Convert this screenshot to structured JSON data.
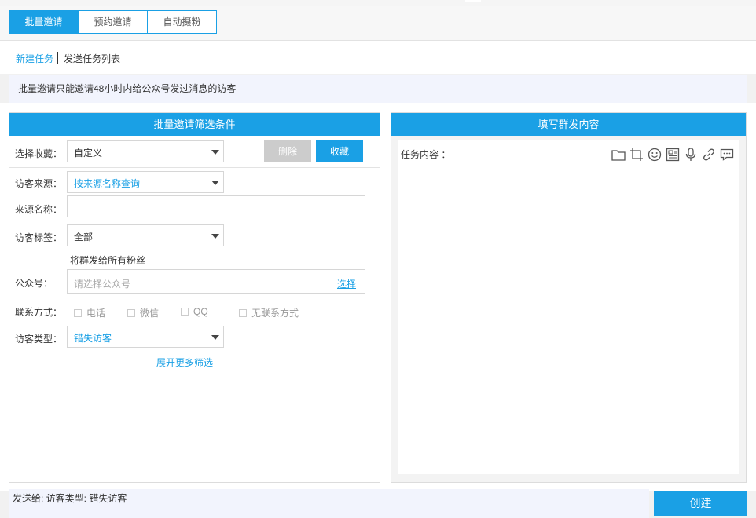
{
  "tabs": [
    {
      "label": "批量邀请",
      "active": true
    },
    {
      "label": "预约邀请",
      "active": false
    },
    {
      "label": "自动摄粉",
      "active": false
    }
  ],
  "subnav": {
    "new_task": "新建任务",
    "task_list": "发送任务列表"
  },
  "notice": "批量邀请只能邀请48小时内给公众号发过消息的访客",
  "filter_panel": {
    "title": "批量邀请筛选条件",
    "favorite": {
      "label": "选择收藏：",
      "value": "自定义",
      "delete_label": "删除",
      "save_label": "收藏"
    },
    "source": {
      "label": "访客来源：",
      "value": "按来源名称查询"
    },
    "source_name": {
      "label": "来源名称：",
      "value": ""
    },
    "tags": {
      "label": "访客标签：",
      "value": "全部"
    },
    "hint": "将群发给所有粉丝",
    "account": {
      "label": "公众号：",
      "placeholder": "请选择公众号",
      "choose_label": "选择"
    },
    "contact": {
      "label": "联系方式：",
      "options": [
        "电话",
        "微信",
        "QQ",
        "无联系方式"
      ]
    },
    "visitor_type": {
      "label": "访客类型：",
      "value": "错失访客"
    },
    "more_label": "展开更多筛选"
  },
  "content_panel": {
    "title": "填写群发内容",
    "task_label": "任务内容 ：",
    "toolbar_icons": [
      "folder-icon",
      "crop-icon",
      "emoji-icon",
      "article-icon",
      "microphone-icon",
      "link-icon",
      "comment-icon"
    ]
  },
  "footer": {
    "send_to": "发送给: 访客类型: 错失访客",
    "create_label": "创建"
  },
  "colors": {
    "accent": "#1aa0e5",
    "notice_bg": "#f2f4fd",
    "disabled": "#cccccc"
  }
}
